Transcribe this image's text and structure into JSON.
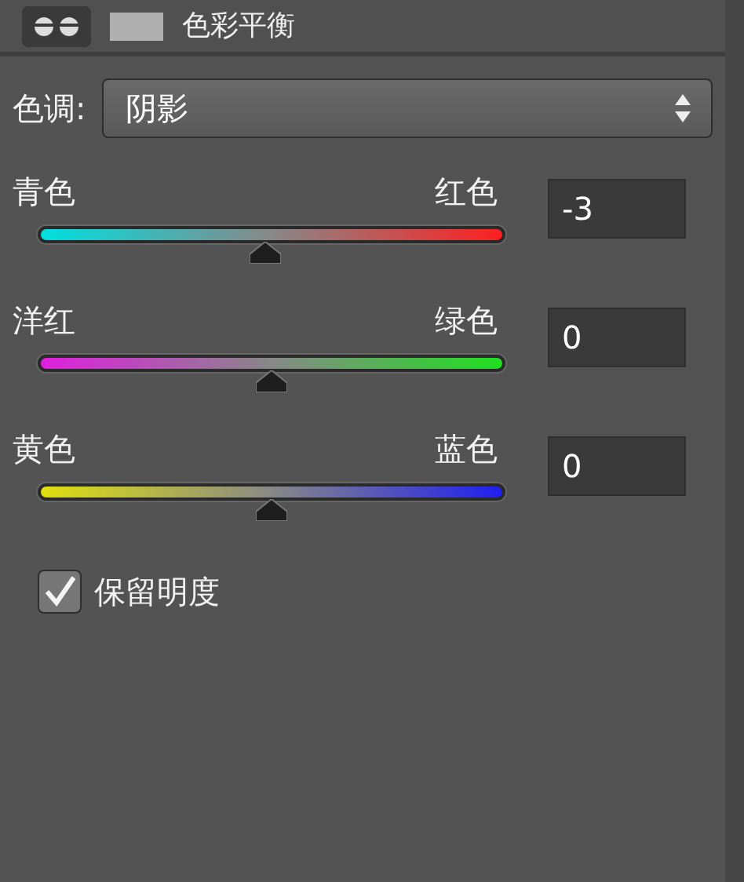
{
  "panel": {
    "title": "色彩平衡"
  },
  "tone": {
    "label": "色调:",
    "value": "阴影"
  },
  "sliders": [
    {
      "left": "青色",
      "right": "红色",
      "color": "#ff1f1f",
      "level": 0.485,
      "value": "-3"
    },
    {
      "left": "洋红",
      "right": "绿色",
      "color": "#1fe01f",
      "level": 0.5,
      "value": "0"
    },
    {
      "left": "黄色",
      "right": "蓝色",
      "color": "#1f1ff0",
      "level": 0.5,
      "value": "0"
    }
  ],
  "preserve_luminosity": {
    "label": "保留明度",
    "checked": true
  }
}
